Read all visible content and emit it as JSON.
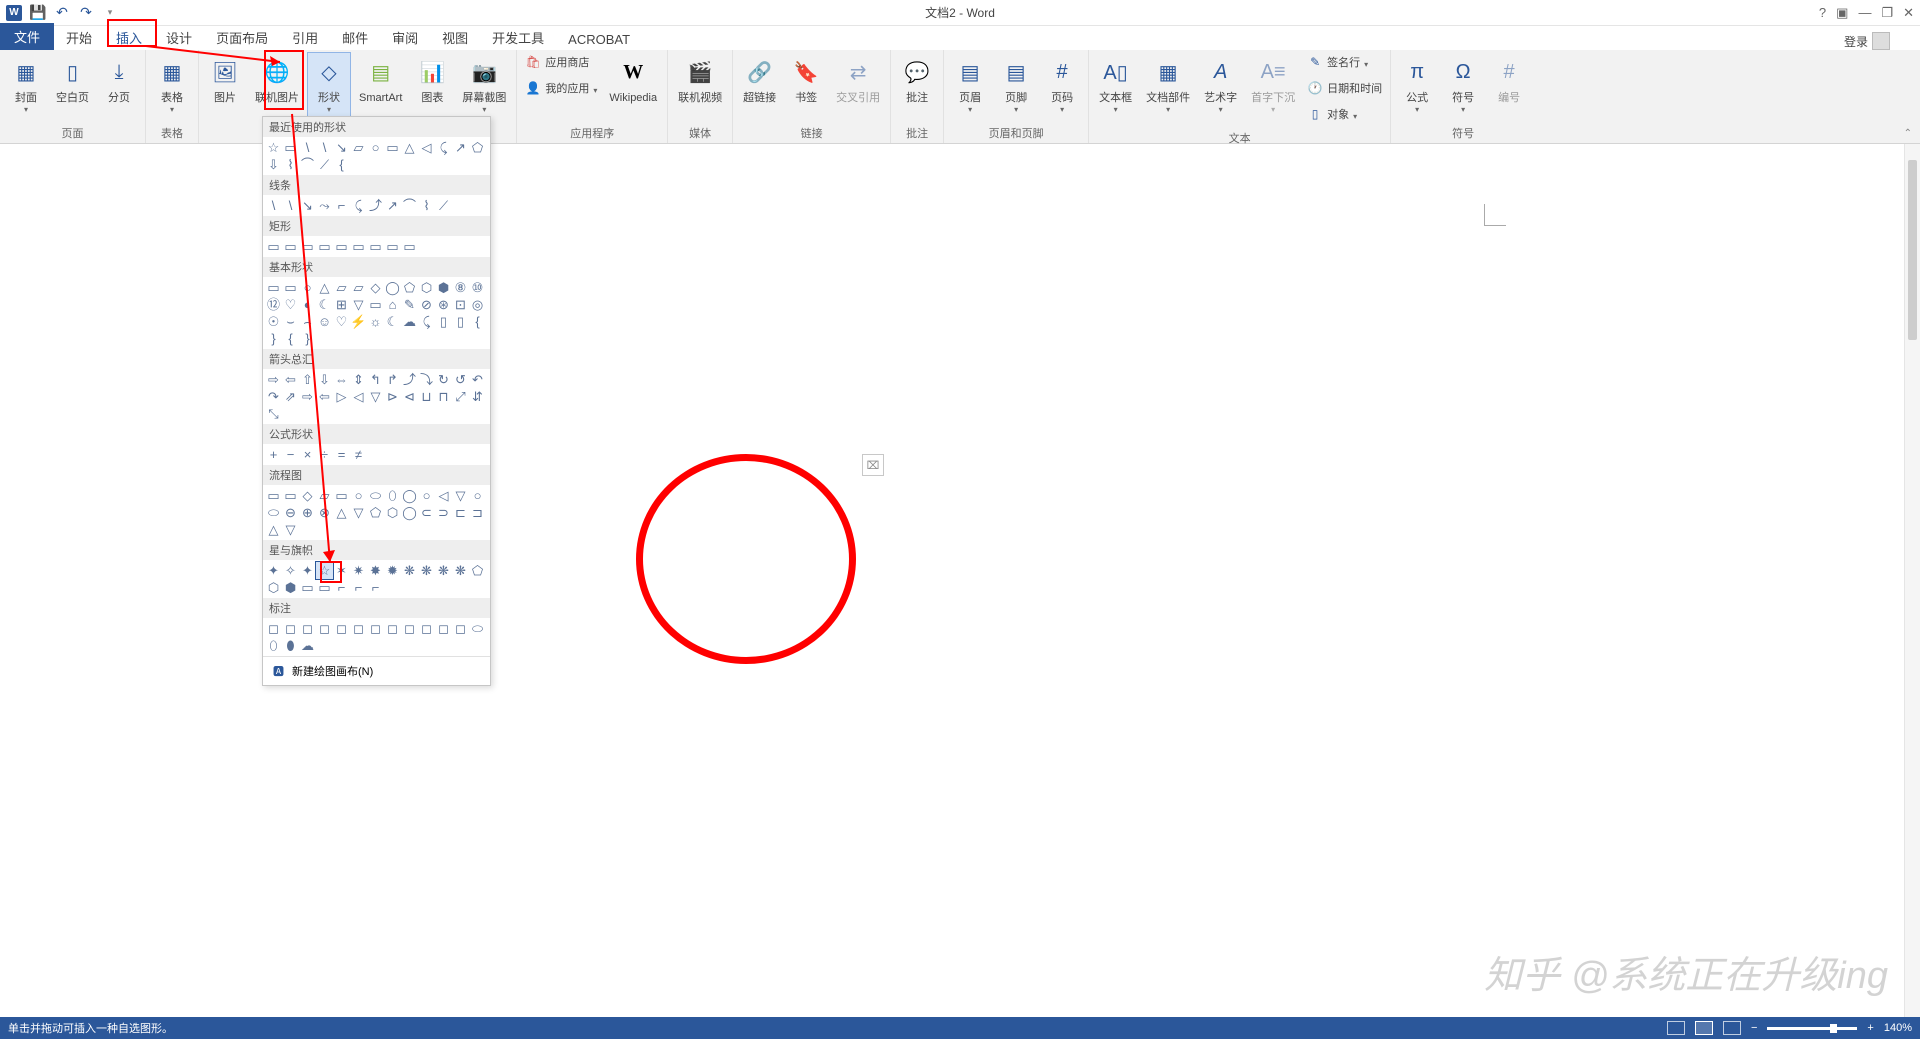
{
  "app": {
    "title": "文档2 - Word",
    "login": "登录"
  },
  "qat": {
    "undo_tip": "撤销",
    "redo_tip": "恢复"
  },
  "window": {
    "help": "?",
    "ribbon_opts": "▣",
    "min": "—",
    "restore": "❐",
    "close": "✕"
  },
  "tabs": {
    "file": "文件",
    "home": "开始",
    "insert": "插入",
    "design": "设计",
    "layout": "页面布局",
    "references": "引用",
    "mailings": "邮件",
    "review": "审阅",
    "view": "视图",
    "developer": "开发工具",
    "acrobat": "ACROBAT"
  },
  "ribbon": {
    "pages": {
      "label": "页面",
      "cover": "封面",
      "blank": "空白页",
      "break": "分页"
    },
    "tables": {
      "label": "表格",
      "table": "表格"
    },
    "illus": {
      "pictures": "图片",
      "online_pic": "联机图片",
      "shapes": "形状",
      "smartart": "SmartArt",
      "chart": "图表",
      "screenshot": "屏幕截图"
    },
    "apps": {
      "label": "应用程序",
      "store": "应用商店",
      "myapps": "我的应用",
      "wikipedia": "Wikipedia"
    },
    "media": {
      "label": "媒体",
      "video": "联机视频"
    },
    "links": {
      "label": "链接",
      "hyperlink": "超链接",
      "bookmark": "书签",
      "crossref": "交叉引用"
    },
    "comments": {
      "label": "批注",
      "comment": "批注"
    },
    "headerfooter": {
      "label": "页眉和页脚",
      "header": "页眉",
      "footer": "页脚",
      "pagenum": "页码"
    },
    "text": {
      "label": "文本",
      "textbox": "文本框",
      "quickparts": "文档部件",
      "wordart": "艺术字",
      "dropcap": "首字下沉",
      "sig": "签名行",
      "datetime": "日期和时间",
      "object": "对象"
    },
    "symbols": {
      "label": "符号",
      "equation": "公式",
      "symbol": "符号",
      "number": "编号"
    }
  },
  "shapes_menu": {
    "recent": "最近使用的形状",
    "lines": "线条",
    "rects": "矩形",
    "basic": "基本形状",
    "arrows": "箭头总汇",
    "equation": "公式形状",
    "flowchart": "流程图",
    "stars": "星与旗帜",
    "callouts": "标注",
    "new_canvas": "新建绘图画布(N)",
    "shape_glyphs": {
      "recent": [
        "☆",
        "▭",
        "\\",
        "\\",
        "↘",
        "▱",
        "○",
        "▭",
        "△",
        "◁",
        "⤹",
        "↗"
      ],
      "recent2": [
        "⬠",
        "⇩",
        "⌇",
        "⌒",
        "⟋",
        "{"
      ],
      "lines": [
        "\\",
        "\\",
        "↘",
        "⤳",
        "⌐",
        "⤹",
        "⤴",
        "↗",
        "⌒",
        "⌇",
        "⟋"
      ],
      "rects": [
        "▭",
        "▭",
        "▭",
        "▭",
        "▭",
        "▭",
        "▭",
        "▭",
        "▭"
      ],
      "basic_rows": [
        [
          "▭",
          "▭",
          "○",
          "△",
          "▱",
          "▱",
          "◇",
          "◯",
          "⬠",
          "⬡",
          "⬢",
          "⑧"
        ],
        [
          "⑩",
          "⑫",
          "♡",
          "◐",
          "☾",
          "⊞",
          "▽",
          "▭",
          "⌂",
          "✎",
          "⊘",
          "⊛"
        ],
        [
          "⊡",
          "◎",
          "☉",
          "⌣",
          "⌢",
          "☺",
          "♡",
          "⚡",
          "☼",
          "☾",
          "☁"
        ],
        [
          "⤹",
          "▯",
          "▯",
          "{",
          "}",
          "{",
          "}"
        ]
      ],
      "arrows_rows": [
        [
          "⇨",
          "⇦",
          "⇧",
          "⇩",
          "⇔",
          "⇕",
          "↰",
          "↱",
          "⤴",
          "⤵",
          "↻",
          "↺"
        ],
        [
          "↶",
          "↷",
          "⇗",
          "⇨",
          "⇦",
          "▷",
          "◁",
          "▽",
          "⊳",
          "⊲",
          "⊔",
          "⊓"
        ],
        [
          "⤢",
          "⇵",
          "⤡"
        ]
      ],
      "equation": [
        "+",
        "−",
        "×",
        "÷",
        "=",
        "≠"
      ],
      "flow_rows": [
        [
          "▭",
          "▭",
          "◇",
          "▱",
          "▭",
          "○",
          "⬭",
          "⬯",
          "◯",
          "○",
          "◁",
          "▽"
        ],
        [
          "○",
          "⬭",
          "⊖",
          "⊕",
          "⊗",
          "△",
          "▽",
          "⬠",
          "⬡",
          "◯",
          "⊂",
          "⊃"
        ],
        [
          "⊏",
          "⊐",
          "△",
          "▽"
        ]
      ],
      "stars_rows": [
        [
          "✦",
          "✧",
          "✦",
          "☆",
          "✶",
          "✷",
          "✸",
          "✹",
          "❋",
          "❋",
          "❋",
          "❋"
        ],
        [
          "⬠",
          "⬡",
          "⬢",
          "▭",
          "▭",
          "⌐",
          "⌐",
          "⌐"
        ]
      ],
      "callouts_rows": [
        [
          "◻",
          "◻",
          "◻",
          "◻",
          "◻",
          "◻",
          "◻",
          "◻",
          "◻",
          "◻",
          "◻",
          "◻"
        ],
        [
          "⬭",
          "⬯",
          "⬮",
          "☁"
        ]
      ]
    }
  },
  "status": {
    "message": "单击并拖动可插入一种自选图形。",
    "zoom": "140%"
  },
  "watermark": "知乎 @系统正在升级ing"
}
